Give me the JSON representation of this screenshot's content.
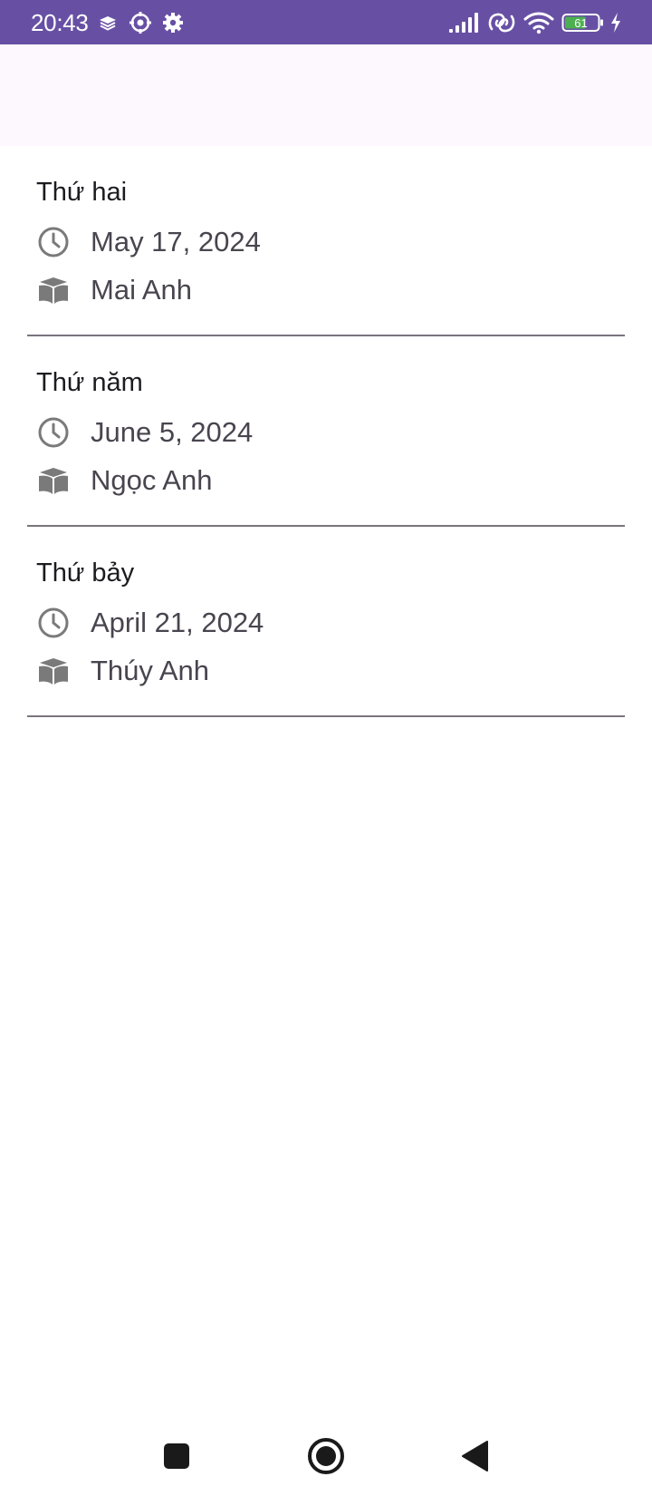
{
  "status_bar": {
    "time": "20:43",
    "battery_level": "61",
    "icons": [
      "layers-icon",
      "camera-settings-icon",
      "gear-icon",
      "signal-icon",
      "link-icon",
      "wifi-icon",
      "battery-icon",
      "charging-icon"
    ]
  },
  "items": [
    {
      "day": "Thứ hai",
      "date": "May 17, 2024",
      "name": "Mai Anh"
    },
    {
      "day": "Thứ năm",
      "date": "June 5, 2024",
      "name": "Ngọc Anh"
    },
    {
      "day": "Thứ bảy",
      "date": "April 21, 2024",
      "name": "Thúy Anh"
    }
  ],
  "nav_bar": {
    "buttons": [
      "recents-button",
      "home-button",
      "back-button"
    ]
  },
  "colors": {
    "status_bar": "#6750a4",
    "app_bar": "#fdf7fe",
    "title_text": "#1c1b1f",
    "secondary_text": "#49454f",
    "icon": "#7a7a7a",
    "divider": "#79747e"
  }
}
